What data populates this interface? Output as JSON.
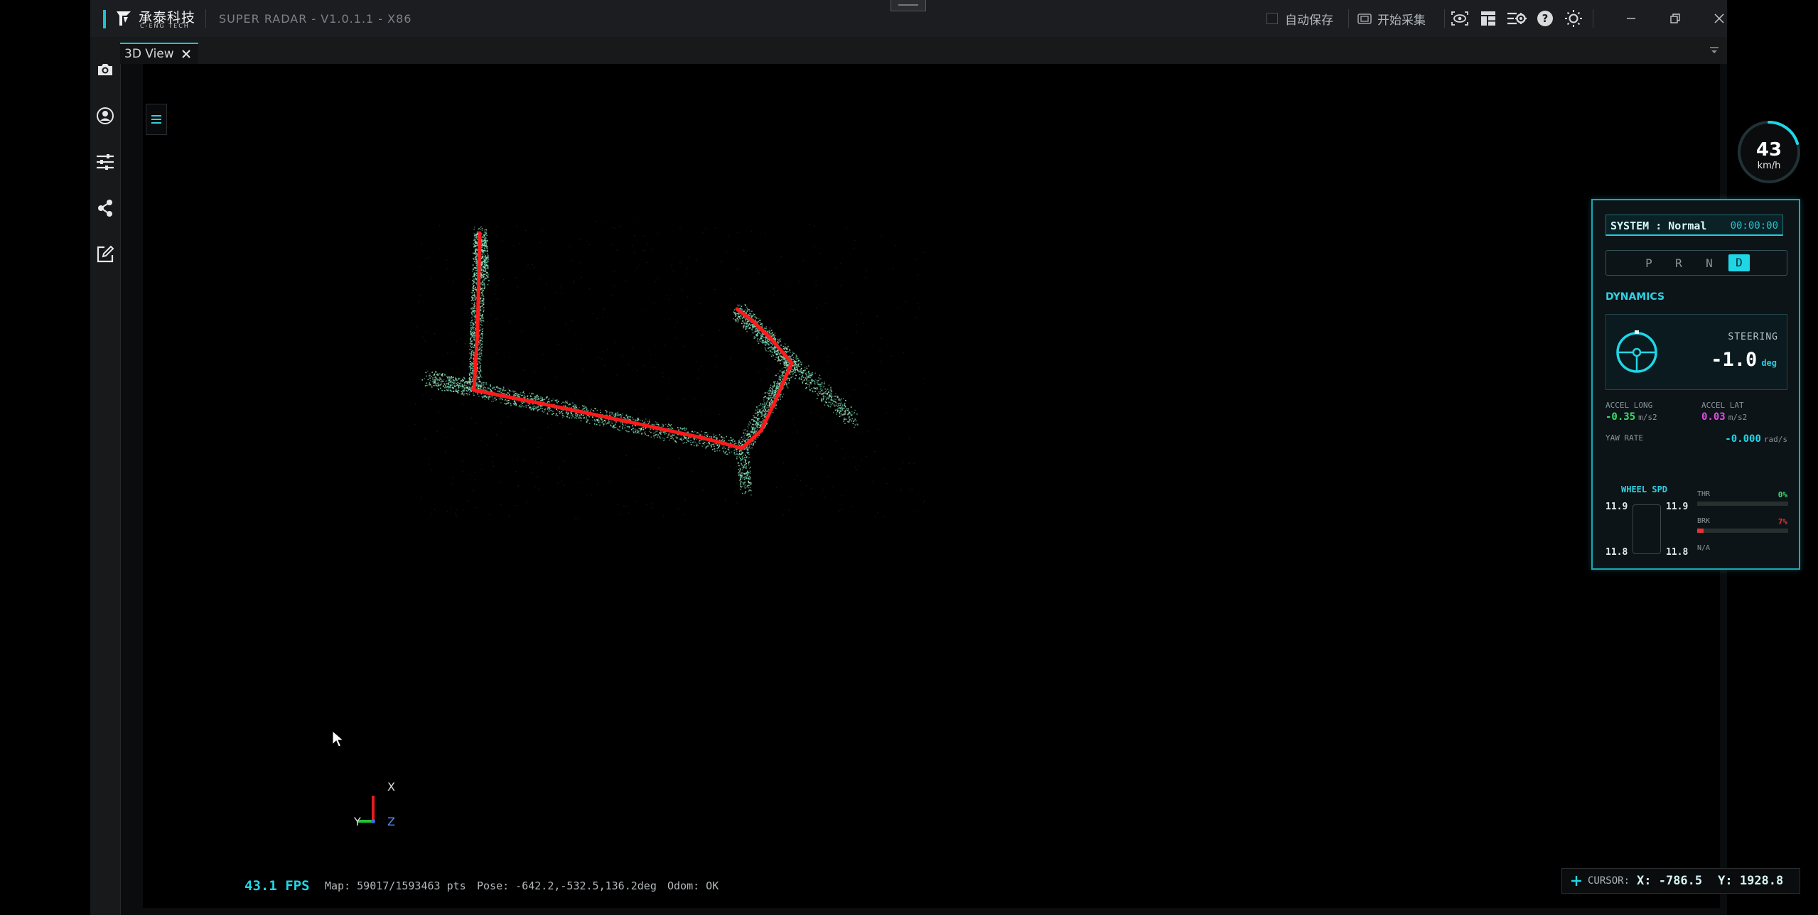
{
  "titlebar": {
    "logo_cn": "承泰科技",
    "logo_en": "C-ENG TECH",
    "app_title": "SUPER RADAR - V1.0.1.1 - X86",
    "autosave_label": "自动保存",
    "start_capture_label": "开始采集",
    "icons": [
      "eye-scan-icon",
      "layout-icon",
      "settings-panel-icon",
      "help-icon",
      "brightness-icon"
    ]
  },
  "sidebar": {
    "items": [
      "camera-icon",
      "user-icon",
      "sliders-icon",
      "share-icon",
      "edit-icon"
    ]
  },
  "tabs": [
    {
      "label": "3D View"
    }
  ],
  "hud": {
    "speed": "43",
    "speed_unit": "km/h",
    "system_label": "SYSTEM : Normal",
    "system_time": "00:00:00",
    "gears": [
      "P",
      "R",
      "N",
      "D"
    ],
    "active_gear": "D",
    "dynamics_label": "DYNAMICS",
    "steering_label": "STEERING",
    "steering_value": "-1.0",
    "steering_unit": "deg",
    "accel_long_label": "ACCEL LONG",
    "accel_long_value": "-0.35",
    "accel_long_unit": "m/s2",
    "accel_lat_label": "ACCEL LAT",
    "accel_lat_value": "0.03",
    "accel_lat_unit": "m/s2",
    "yaw_label": "YAW RATE",
    "yaw_value": "-0.000",
    "yaw_unit": "rad/s",
    "wheel_label": "WHEEL SPD",
    "wheel_fl": "11.9",
    "wheel_fr": "11.9",
    "wheel_rl": "11.8",
    "wheel_rr": "11.8",
    "thr_label": "THR",
    "thr_value": "0%",
    "thr_level": 0,
    "brk_label": "BRK",
    "brk_value": "7%",
    "brk_level": 0.07,
    "na_label": "N/A"
  },
  "status": {
    "fps": "43.1 FPS",
    "map": "Map: 59017/1593463 pts",
    "pose": "Pose: -642.2,-532.5,136.2deg",
    "odom": "Odom: OK",
    "cursor_label": "CURSOR:",
    "cursor_x": "X: -786.5",
    "cursor_y": "Y: 1928.8"
  },
  "axes": {
    "x": "X",
    "y": "Y",
    "z": "Z"
  },
  "colors": {
    "accent": "#1fd6e6",
    "trajectory": "#ff1a1a",
    "points": "#7fe6c1",
    "accel_long": "#35e26b",
    "accel_lat": "#e14de6",
    "brake": "#e63232"
  }
}
